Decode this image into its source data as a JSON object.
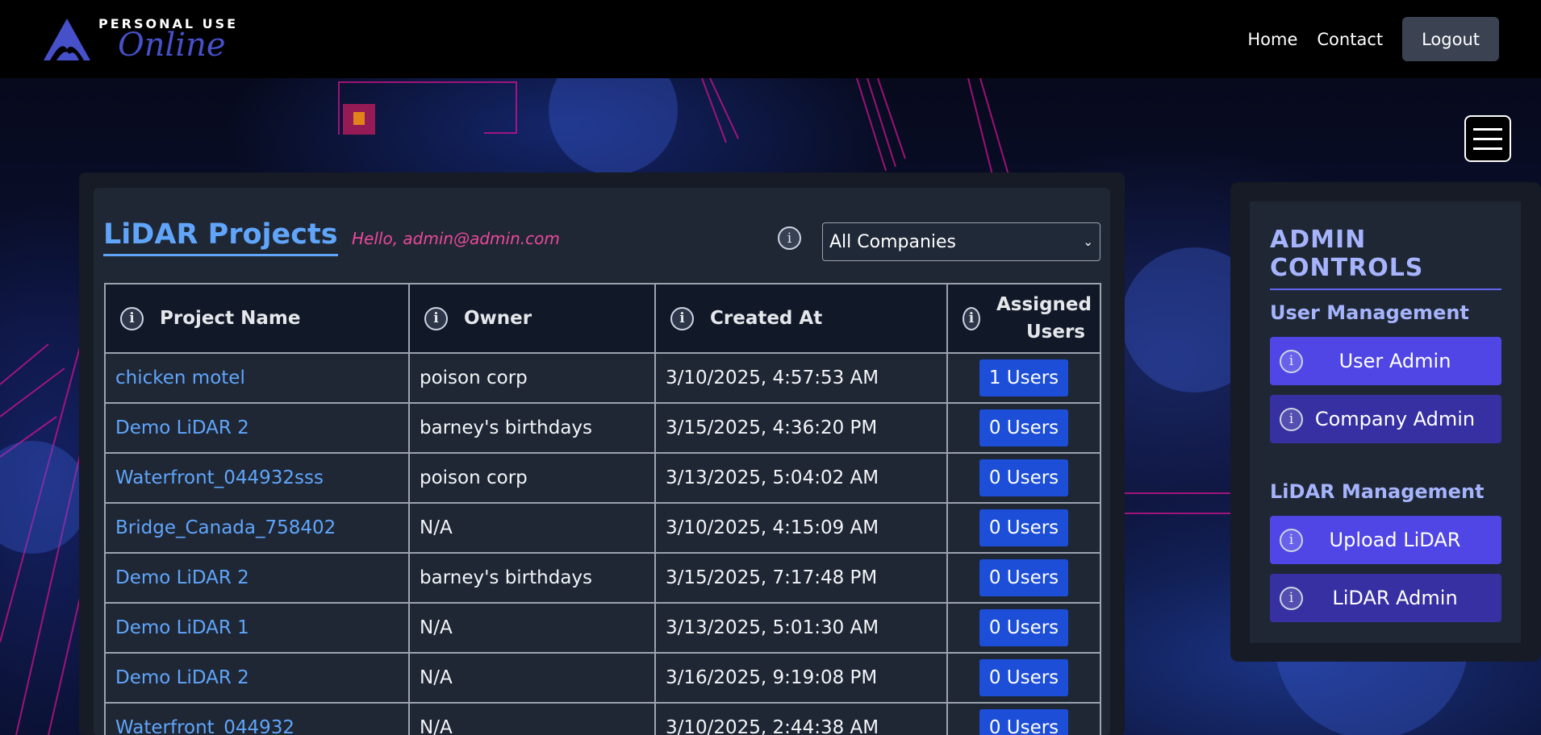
{
  "navbar": {
    "logo_top": "PERSONAL USE",
    "logo_bottom": "Online",
    "links": [
      "Home",
      "Contact"
    ],
    "logout_label": "Logout"
  },
  "main": {
    "title": "LiDAR Projects",
    "greeting": "Hello, admin@admin.com",
    "filter": {
      "info": "i",
      "selected": "All Companies"
    },
    "table": {
      "headers": [
        "Project Name",
        "Owner",
        "Created At",
        "Assigned Users"
      ],
      "rows": [
        {
          "name": "chicken motel",
          "owner": "poison corp",
          "created": "3/10/2025, 4:57:53 AM",
          "users": "1 Users"
        },
        {
          "name": "Demo LiDAR 2",
          "owner": "barney's birthdays",
          "created": "3/15/2025, 4:36:20 PM",
          "users": "0 Users"
        },
        {
          "name": "Waterfront_044932sss",
          "owner": "poison corp",
          "created": "3/13/2025, 5:04:02 AM",
          "users": "0 Users"
        },
        {
          "name": "Bridge_Canada_758402",
          "owner": "N/A",
          "created": "3/10/2025, 4:15:09 AM",
          "users": "0 Users"
        },
        {
          "name": "Demo LiDAR 2",
          "owner": "barney's birthdays",
          "created": "3/15/2025, 7:17:48 PM",
          "users": "0 Users"
        },
        {
          "name": "Demo LiDAR 1",
          "owner": "N/A",
          "created": "3/13/2025, 5:01:30 AM",
          "users": "0 Users"
        },
        {
          "name": "Demo LiDAR 2",
          "owner": "N/A",
          "created": "3/16/2025, 9:19:08 PM",
          "users": "0 Users"
        },
        {
          "name": "Waterfront_044932",
          "owner": "N/A",
          "created": "3/10/2025, 2:44:38 AM",
          "users": "0 Users"
        }
      ]
    }
  },
  "admin": {
    "title": "ADMIN CONTROLS",
    "user_section": "User Management",
    "user_admin": "User Admin",
    "company_admin": "Company Admin",
    "lidar_section": "LiDAR Management",
    "upload_lidar": "Upload LiDAR",
    "lidar_admin": "LiDAR Admin"
  },
  "info_glyph": "i",
  "icons": [
    "logo-mountain-icon",
    "info-icon",
    "chevron-down-icon",
    "hamburger-menu-icon"
  ],
  "colors": {
    "accent_blue": "#60a5fa",
    "greeting_pink": "#ec4899",
    "users_button": "#1d4ed8",
    "admin_button": "#4f46e5",
    "admin_button_dark": "#3730a3",
    "admin_text": "#a5b4fc"
  }
}
